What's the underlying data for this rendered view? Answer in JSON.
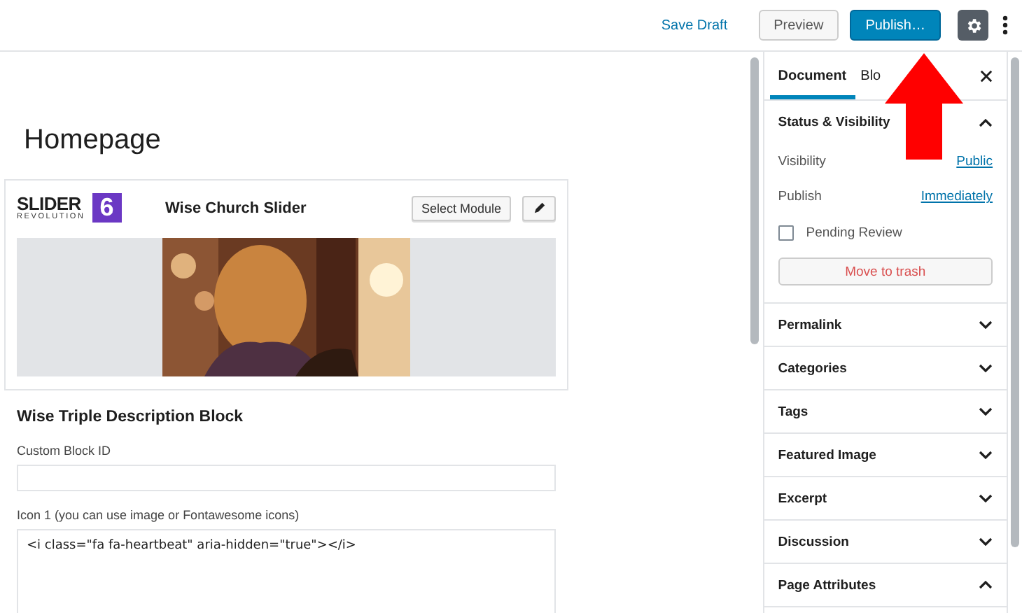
{
  "toolbar": {
    "save_draft": "Save Draft",
    "preview": "Preview",
    "publish": "Publish…"
  },
  "editor": {
    "title": "Homepage",
    "slider_block": {
      "logo": {
        "word": "SLIDER",
        "subword": "REVOLUTION",
        "badge": "6"
      },
      "name": "Wise Church Slider",
      "select_button": "Select Module"
    },
    "description_block": {
      "heading": "Wise Triple Description Block",
      "fields": [
        {
          "label": "Custom Block ID",
          "kind": "input"
        },
        {
          "label": "Icon 1 (you can use image or Fontawesome icons)",
          "kind": "textarea",
          "value": "<i class=\"fa fa-heartbeat\" aria-hidden=\"true\"></i>"
        }
      ]
    }
  },
  "sidebar": {
    "tabs": [
      {
        "label": "Document",
        "selected": true
      },
      {
        "label": "Blo",
        "selected": false
      }
    ],
    "status_panel": {
      "title": "Status & Visibility",
      "expanded": true,
      "rows": [
        {
          "label": "Visibility",
          "value": "Public"
        },
        {
          "label": "Publish",
          "value": "Immediately"
        }
      ],
      "pending_review": {
        "label": "Pending Review",
        "checked": false
      },
      "trash_button": "Move to trash"
    },
    "panels": [
      {
        "title": "Permalink",
        "expanded": false
      },
      {
        "title": "Categories",
        "expanded": false
      },
      {
        "title": "Tags",
        "expanded": false
      },
      {
        "title": "Featured Image",
        "expanded": false
      },
      {
        "title": "Excerpt",
        "expanded": false
      },
      {
        "title": "Discussion",
        "expanded": false
      },
      {
        "title": "Page Attributes",
        "expanded": true
      }
    ]
  }
}
